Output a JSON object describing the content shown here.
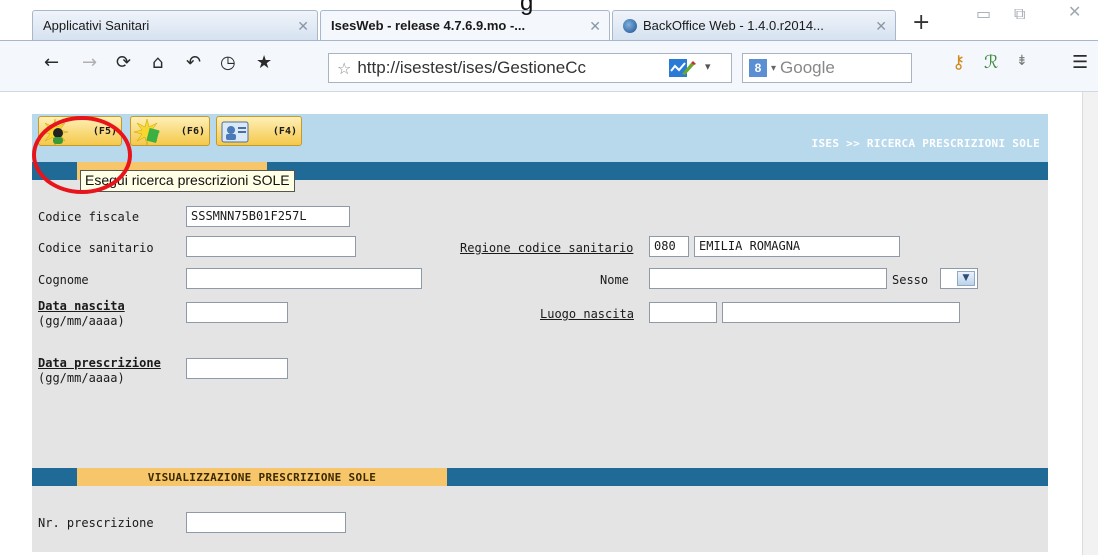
{
  "browser": {
    "tabs": [
      {
        "title": "Applicativi Sanitari",
        "active": false
      },
      {
        "title": "IsesWeb - release 4.7.6.9.mo -...",
        "active": true
      },
      {
        "title": "BackOffice Web - 1.4.0.r2014...",
        "active": false
      }
    ],
    "new_tab": "+",
    "url": "http://isestest/ises/GestioneCc",
    "search_placeholder": "Google",
    "search_engine_glyph": "8"
  },
  "page": {
    "caption_fragment": "g",
    "breadcrumb": "ISES >> RICERCA PRESCRIZIONI SOLE",
    "toolbar": {
      "f5_label": "(F5)",
      "f6_label": "(F6)",
      "f4_label": "(F4)"
    },
    "tooltip": "Esegui ricerca prescrizioni SOLE",
    "form": {
      "codice_fiscale_label": "Codice fiscale",
      "codice_fiscale_value": "SSSMNN75B01F257L",
      "codice_sanitario_label": "Codice sanitario",
      "codice_sanitario_value": "",
      "regione_label": "Regione codice sanitario",
      "regione_code": "080",
      "regione_name": "EMILIA ROMAGNA",
      "cognome_label": "Cognome",
      "cognome_value": "",
      "nome_label": "Nome",
      "nome_value": "",
      "sesso_label": "Sesso",
      "sesso_value": "",
      "data_nascita_label": "Data nascita",
      "data_nascita_format": "(gg/mm/aaaa)",
      "data_nascita_value": "",
      "luogo_nascita_label": "Luogo nascita",
      "luogo_nascita_code": "",
      "luogo_nascita_name": "",
      "data_prescrizione_label": "Data prescrizione",
      "data_prescrizione_format": "(gg/mm/aaaa)",
      "data_prescrizione_value": ""
    },
    "section2": {
      "title": "VISUALIZZAZIONE PRESCRIZIONE SOLE",
      "nr_prescrizione_label": "Nr. prescrizione",
      "nr_prescrizione_value": ""
    }
  },
  "colors": {
    "header_band": "#b8d8ec",
    "section_bar": "#1f6a96",
    "section_tab": "#f8c66a",
    "form_bg": "#e4e4e4",
    "highlight_circle": "#e8141c"
  }
}
